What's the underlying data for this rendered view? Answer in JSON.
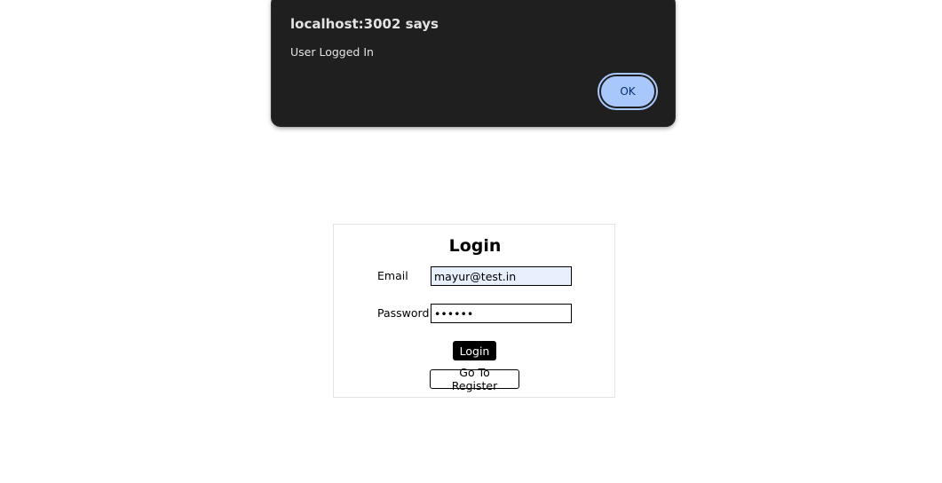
{
  "alert": {
    "title": "localhost:3002 says",
    "message": "User Logged In",
    "ok_label": "OK"
  },
  "login_form": {
    "title": "Login",
    "email_label": "Email",
    "email_value": "mayur@test.in",
    "password_label": "Password",
    "password_value": "••••••",
    "login_button": "Login",
    "register_button": "Go To Register"
  },
  "colors": {
    "alert_background": "#1f1f1f",
    "ok_button": "#a8c7fa",
    "email_autofill_background": "#e8f0fe",
    "login_button_background": "#000000"
  }
}
